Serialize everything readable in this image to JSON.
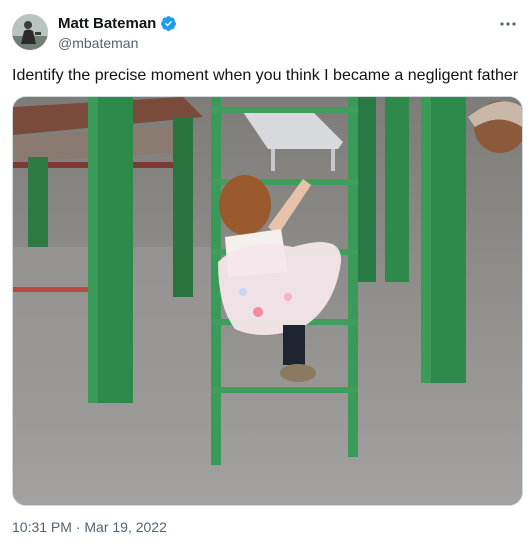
{
  "tweet": {
    "author": {
      "display_name": "Matt Bateman",
      "handle": "@mbateman",
      "verified": true,
      "avatar_icon": "avatar-photo"
    },
    "text": "Identify the precise moment when you think I became a negligent father",
    "media": {
      "type": "photo",
      "icon": "playground-photo"
    },
    "timestamp": "10:31 PM · Mar 19, 2022",
    "more_icon": "more-options-icon"
  },
  "colors": {
    "verified_badge": "#1d9bf0",
    "secondary_text": "#536471",
    "primary_text": "#0f1419",
    "playground_green": "#2f8a4a"
  }
}
